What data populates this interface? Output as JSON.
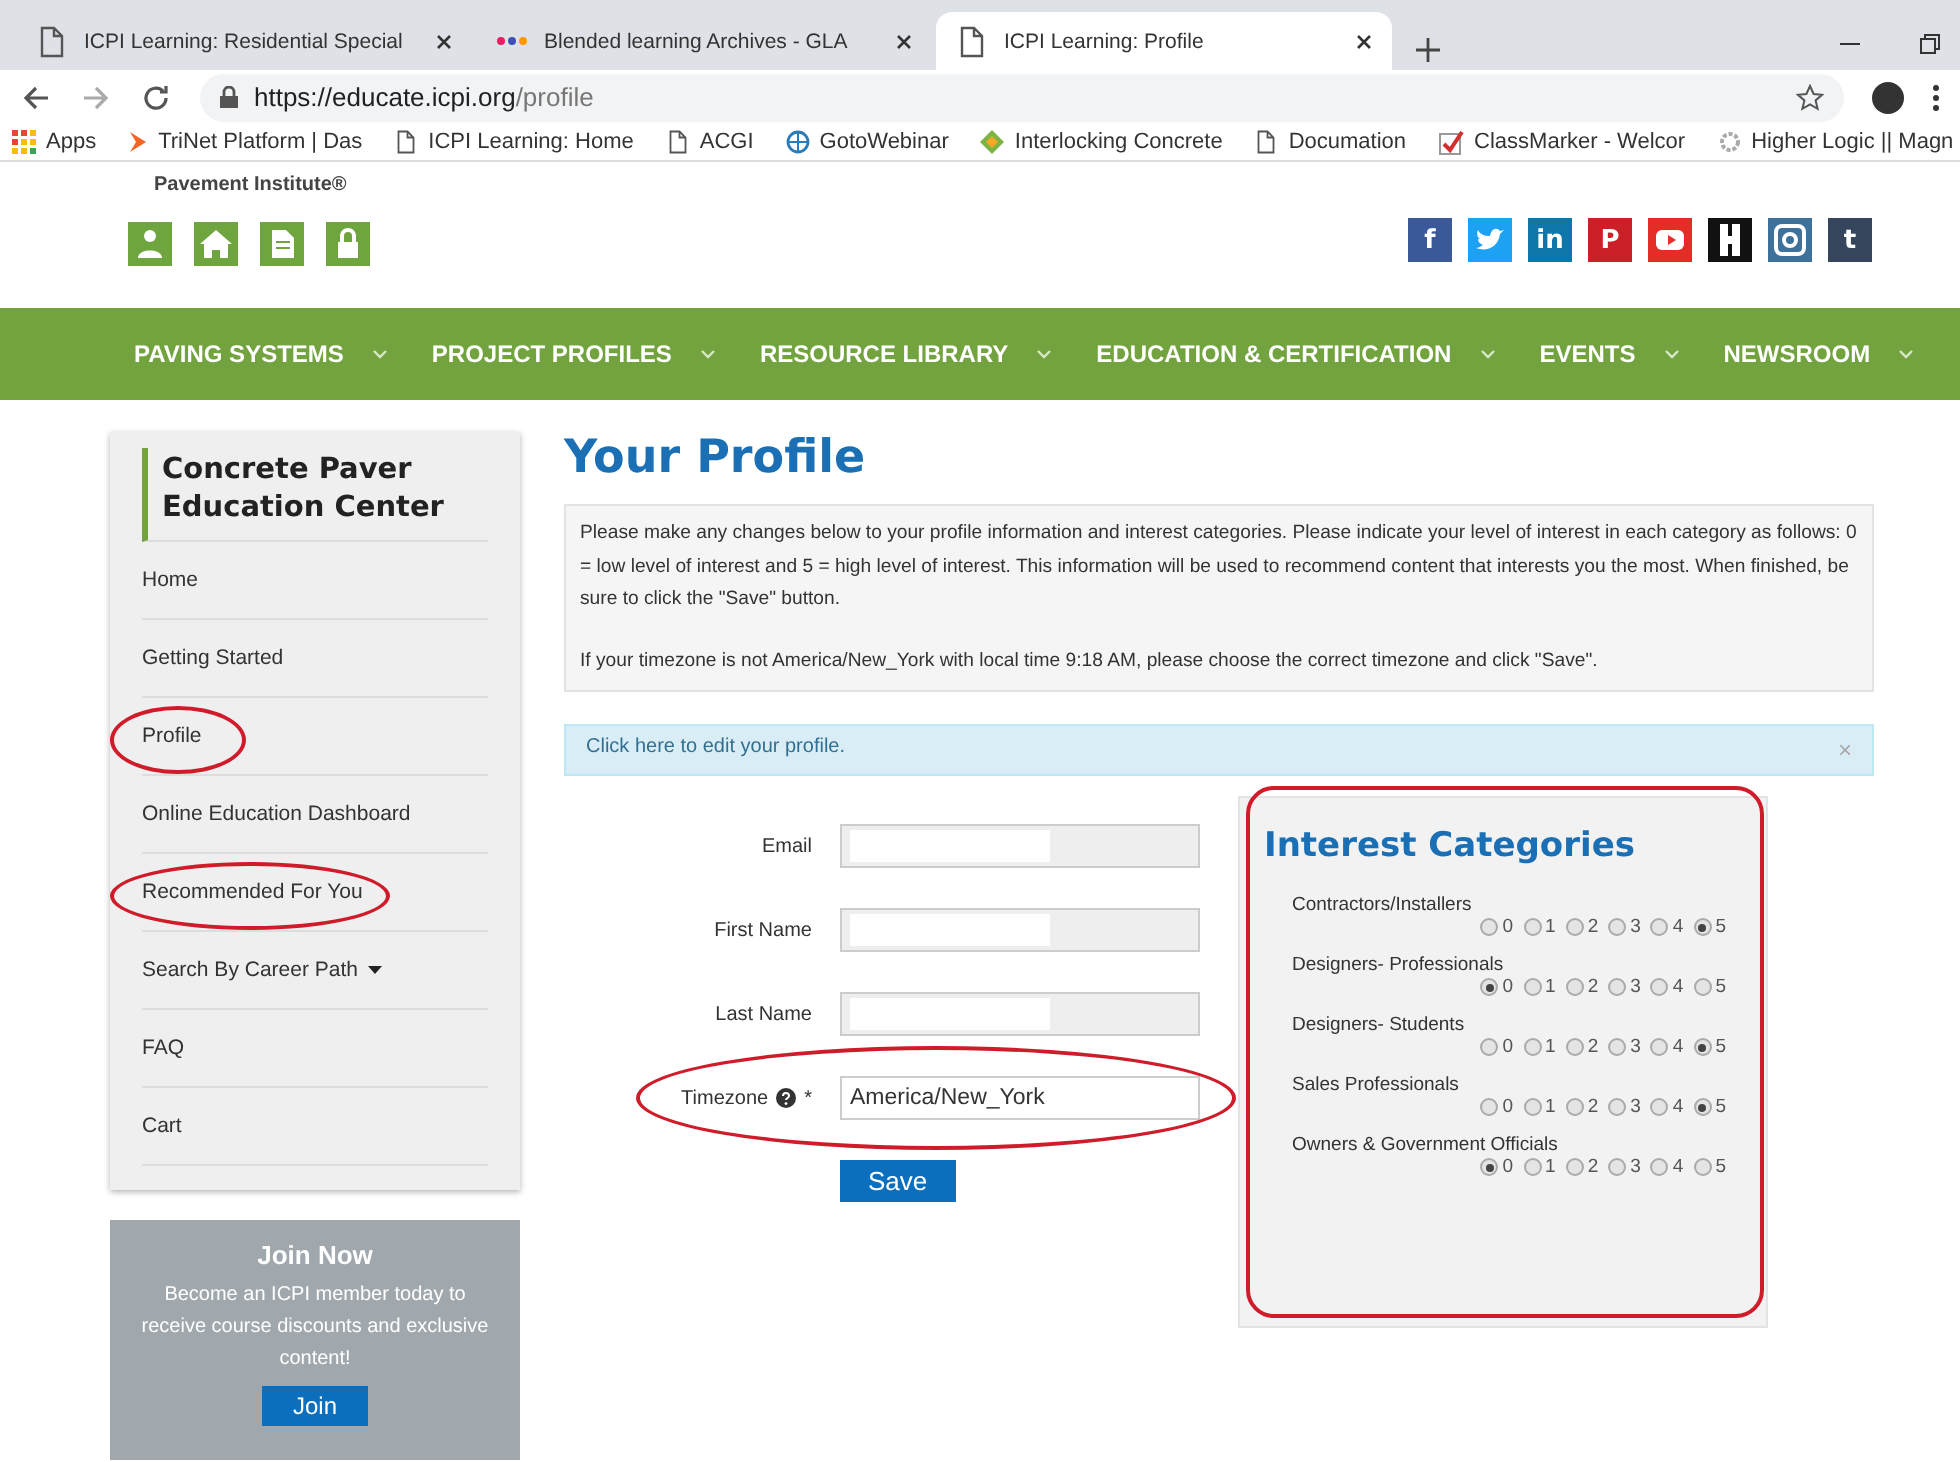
{
  "browser": {
    "tabs": [
      {
        "title": "ICPI Learning: Residential Special",
        "kind": "page",
        "selected": false
      },
      {
        "title": "Blended learning Archives - GLA",
        "kind": "colorful",
        "selected": false
      },
      {
        "title": "ICPI Learning: Profile",
        "kind": "page",
        "selected": true
      }
    ],
    "url_host": "https://educate.icpi.org",
    "url_path": "/profile",
    "bookmarks": [
      {
        "label": "Apps",
        "kind": "apps"
      },
      {
        "label": "TriNet Platform | Das",
        "kind": "arrow"
      },
      {
        "label": "ICPI Learning: Home",
        "kind": "page"
      },
      {
        "label": "ACGI",
        "kind": "page"
      },
      {
        "label": "GotoWebinar",
        "kind": "globe"
      },
      {
        "label": "Interlocking Concrete",
        "kind": "diamond"
      },
      {
        "label": "Documation",
        "kind": "page"
      },
      {
        "label": "ClassMarker - Welcor",
        "kind": "check"
      },
      {
        "label": "Higher Logic || Magn",
        "kind": "flower"
      }
    ]
  },
  "header": {
    "logo_text": "Pavement Institute®",
    "quick_links": [
      {
        "kind": "person"
      },
      {
        "kind": "home"
      },
      {
        "kind": "document"
      },
      {
        "kind": "lock"
      }
    ],
    "social": [
      {
        "kind": "square",
        "glyph": "f",
        "color": "#3b5998"
      },
      {
        "kind": "bird",
        "color": "#1da1f2"
      },
      {
        "kind": "square",
        "glyph": "in",
        "color": "#0e76a8"
      },
      {
        "kind": "square",
        "glyph": "P",
        "color": "#cb2027"
      },
      {
        "kind": "play",
        "color": "#e52d27"
      },
      {
        "kind": "blocks",
        "color": "#111111"
      },
      {
        "kind": "camera",
        "color": "#3f729b"
      },
      {
        "kind": "square",
        "glyph": "t",
        "color": "#35465c"
      }
    ]
  },
  "nav": [
    "PAVING SYSTEMS",
    "PROJECT PROFILES",
    "RESOURCE LIBRARY",
    "EDUCATION & CERTIFICATION",
    "EVENTS",
    "NEWSROOM"
  ],
  "sidebar": {
    "title": "Concrete Paver Education Center",
    "items": [
      {
        "label": "Home",
        "circled": false,
        "dropdown": false
      },
      {
        "label": "Getting Started",
        "circled": false,
        "dropdown": false
      },
      {
        "label": "Profile",
        "circled": true,
        "dropdown": false
      },
      {
        "label": "Online Education Dashboard",
        "circled": false,
        "dropdown": false
      },
      {
        "label": "Recommended For You",
        "circled": true,
        "dropdown": false
      },
      {
        "label": "Search By Career Path",
        "circled": false,
        "dropdown": true
      },
      {
        "label": "FAQ",
        "circled": false,
        "dropdown": false
      },
      {
        "label": "Cart",
        "circled": false,
        "dropdown": false
      }
    ],
    "join": {
      "title": "Join Now",
      "text": "Become an ICPI member today to receive course discounts and exclusive content!",
      "button": "Join"
    }
  },
  "main": {
    "title": "Your Profile",
    "intro": [
      "Please make any changes below to your profile information and interest categories. Please indicate your level of interest in each category as follows: 0 = low level of interest and 5 = high level of interest. This information will be used to recommend content that interests you the most. When finished, be sure to click the \"Save\" button.",
      "If your timezone is not America/New_York with local time 9:18 AM, please choose the correct timezone and click \"Save\"."
    ],
    "alert": {
      "text": "Click here to edit your profile.",
      "close": "×"
    },
    "required_mark": "*",
    "fields": [
      {
        "label": "Email",
        "redacted": true,
        "circled": false,
        "required": false,
        "help": false
      },
      {
        "label": "First Name",
        "redacted": true,
        "circled": false,
        "required": false,
        "help": false
      },
      {
        "label": "Last Name",
        "redacted": true,
        "circled": false,
        "required": false,
        "help": false
      },
      {
        "label": "Timezone",
        "value": "America/New_York",
        "redacted": false,
        "circled": true,
        "required": true,
        "help": true
      }
    ],
    "save": "Save",
    "interests": {
      "title": "Interest Categories",
      "circled": true,
      "categories": [
        {
          "name": "Contractors/Installers",
          "options": [
            {
              "label": "0",
              "selected": false
            },
            {
              "label": "1",
              "selected": false
            },
            {
              "label": "2",
              "selected": false
            },
            {
              "label": "3",
              "selected": false
            },
            {
              "label": "4",
              "selected": false
            },
            {
              "label": "5",
              "selected": true
            }
          ]
        },
        {
          "name": "Designers- Professionals",
          "options": [
            {
              "label": "0",
              "selected": true
            },
            {
              "label": "1",
              "selected": false
            },
            {
              "label": "2",
              "selected": false
            },
            {
              "label": "3",
              "selected": false
            },
            {
              "label": "4",
              "selected": false
            },
            {
              "label": "5",
              "selected": false
            }
          ]
        },
        {
          "name": "Designers- Students",
          "options": [
            {
              "label": "0",
              "selected": false
            },
            {
              "label": "1",
              "selected": false
            },
            {
              "label": "2",
              "selected": false
            },
            {
              "label": "3",
              "selected": false
            },
            {
              "label": "4",
              "selected": false
            },
            {
              "label": "5",
              "selected": true
            }
          ]
        },
        {
          "name": "Sales Professionals",
          "options": [
            {
              "label": "0",
              "selected": false
            },
            {
              "label": "1",
              "selected": false
            },
            {
              "label": "2",
              "selected": false
            },
            {
              "label": "3",
              "selected": false
            },
            {
              "label": "4",
              "selected": false
            },
            {
              "label": "5",
              "selected": true
            }
          ]
        },
        {
          "name": "Owners & Government Officials",
          "options": [
            {
              "label": "0",
              "selected": true
            },
            {
              "label": "1",
              "selected": false
            },
            {
              "label": "2",
              "selected": false
            },
            {
              "label": "3",
              "selected": false
            },
            {
              "label": "4",
              "selected": false
            },
            {
              "label": "5",
              "selected": false
            }
          ]
        }
      ]
    }
  }
}
